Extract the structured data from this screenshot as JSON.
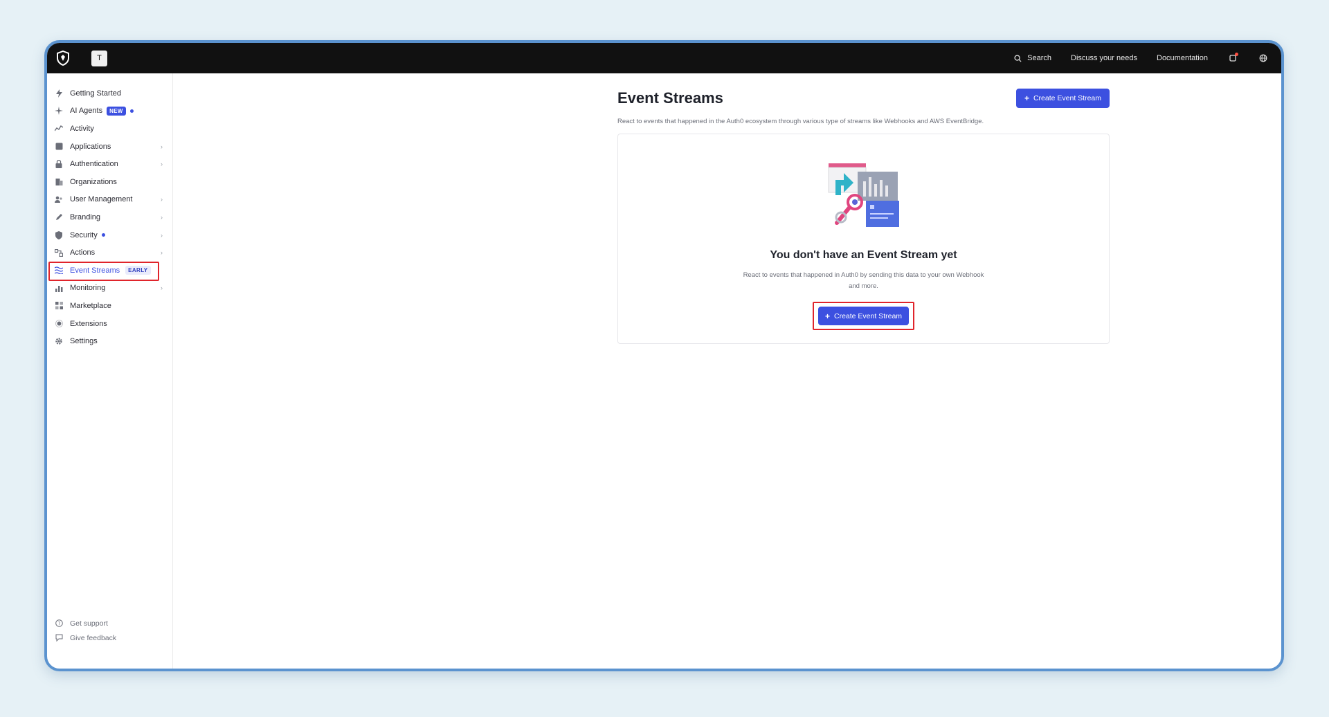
{
  "topbar": {
    "tenant_initial": "T",
    "search_label": "Search",
    "discuss_label": "Discuss your needs",
    "docs_label": "Documentation"
  },
  "sidebar": {
    "items": [
      {
        "label": "Getting Started",
        "icon": "bolt-icon"
      },
      {
        "label": "AI Agents",
        "icon": "sparkle-icon",
        "badge": "NEW"
      },
      {
        "label": "Activity",
        "icon": "activity-icon"
      },
      {
        "label": "Applications",
        "icon": "applications-icon"
      },
      {
        "label": "Authentication",
        "icon": "lock-icon"
      },
      {
        "label": "Organizations",
        "icon": "building-icon"
      },
      {
        "label": "User Management",
        "icon": "users-icon"
      },
      {
        "label": "Branding",
        "icon": "pen-icon"
      },
      {
        "label": "Security",
        "icon": "shield-icon"
      },
      {
        "label": "Actions",
        "icon": "actions-icon"
      },
      {
        "label": "Event Streams",
        "icon": "event-streams-icon",
        "badge": "EARLY"
      },
      {
        "label": "Monitoring",
        "icon": "bar-chart-icon"
      },
      {
        "label": "Marketplace",
        "icon": "marketplace-icon"
      },
      {
        "label": "Extensions",
        "icon": "extensions-icon"
      },
      {
        "label": "Settings",
        "icon": "gear-icon"
      }
    ],
    "footer": [
      {
        "label": "Get support",
        "icon": "help-icon"
      },
      {
        "label": "Give feedback",
        "icon": "feedback-icon"
      }
    ]
  },
  "main": {
    "title": "Event Streams",
    "create_button_label": "Create Event Stream",
    "description": "React to events that happened in the Auth0 ecosystem through various type of streams like Webhooks and AWS EventBridge.",
    "empty_state": {
      "title": "You don't have an Event Stream yet",
      "description": "React to events that happened in Auth0 by sending this data to your own Webhook and more.",
      "cta_label": "Create Event Stream"
    }
  },
  "colors": {
    "accent": "#3c50e0",
    "highlight": "#e0242b",
    "topbar": "#111111",
    "frame": "#5b93cf"
  }
}
